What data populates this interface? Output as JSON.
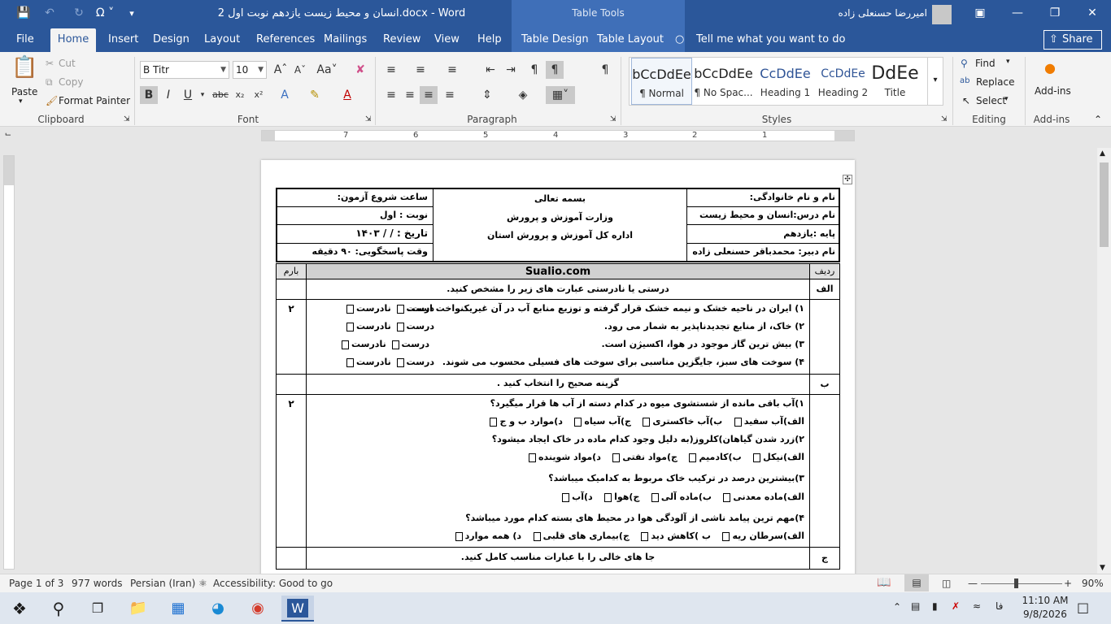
{
  "window": {
    "title": "انسان و محیط زیست یازدهم نوبت اول 2.docx - Word",
    "table_tools": "Table Tools",
    "user": "امیررضا حسنعلی زاده"
  },
  "tabs": [
    "File",
    "Home",
    "Insert",
    "Design",
    "Layout",
    "References",
    "Mailings",
    "Review",
    "View",
    "Help",
    "Table Design",
    "Table Layout"
  ],
  "tell_me": "Tell me what you want to do",
  "share": "Share",
  "clipboard": {
    "paste": "Paste",
    "cut": "Cut",
    "copy": "Copy",
    "format_painter": "Format Painter",
    "label": "Clipboard"
  },
  "font": {
    "name": "B Titr",
    "size": "10",
    "label": "Font"
  },
  "paragraph": {
    "label": "Paragraph"
  },
  "styles": {
    "label": "Styles",
    "items": [
      {
        "preview": "bCcDdEe",
        "name": "¶ Normal"
      },
      {
        "preview": "bCcDdEe",
        "name": "¶ No Spac..."
      },
      {
        "preview": "CcDdEe",
        "name": "Heading 1"
      },
      {
        "preview": "CcDdEe",
        "name": "Heading 2"
      },
      {
        "preview": "DdEe",
        "name": "Title"
      }
    ]
  },
  "editing": {
    "find": "Find",
    "replace": "Replace",
    "select": "Select",
    "label": "Editing"
  },
  "addins": {
    "button": "Add-ins",
    "label": "Add-ins"
  },
  "ruler": {
    "numbers": [
      "7",
      "6",
      "5",
      "4",
      "3",
      "2",
      "1"
    ]
  },
  "doc": {
    "header": {
      "name": "نام و نام خانوادگی:",
      "course": "نام درس:انسان و محیط زیست",
      "grade": "پایه :یازدهم",
      "teacher": "نام دبیر: محمدباقر حسنعلی زاده",
      "center1": "بسمه تعالی",
      "center2": "وزارت آموزش و پرورش",
      "center3": "اداره کل آموزش و پرورش استان",
      "start": "ساعت شروع آزمون:",
      "term": "نوبت   : اول",
      "date": "تاریخ   :     /    /  ۱۴۰۳",
      "duration": "وقت پاسخگویی: ۹۰ دقیقه"
    },
    "col_row": "ردیف",
    "col_site": "Sualio.com",
    "col_score": "بارم",
    "sec_a": {
      "letter": "الف",
      "title": "درستی یا نادرستی عبارت های زیر را مشخص کنید.",
      "score": "۲",
      "items": [
        "۱) ایران در ناحیه خشک و نیمه خشک قرار گرفته و توزیع منابع آب در آن غیریکنواخت است.",
        "۲) خاک، از منابع تجدیدناپذیر به شمار می رود.",
        "۳) بیش ترین گاز موجود در هوا، اکسیژن است.",
        "۴) سوخت های سبز، جایگزین مناسبی برای سوخت های فسیلی محسوب می شوند."
      ],
      "true": "درست",
      "false": "نادرست"
    },
    "sec_b": {
      "letter": "ب",
      "title": "گزینه صحیح را انتخاب کنید .",
      "score": "۲",
      "q1": "۱)آب باقی مانده از شستشوی میوه در کدام دسته از آب ها قرار میگیرد؟",
      "q1o": [
        "الف)آب سفید",
        "ب)آب خاکستری",
        "ج)آب سیاه",
        "د)موارد ب و ج"
      ],
      "q2": "۲)زرد شدن گیاهان)کلروز(به دلیل وجود کدام ماده در خاک ایجاد میشود؟",
      "q2o": [
        "الف)نیکل",
        "ب)کادمیم",
        "ج)مواد نفتی",
        "د)مواد شوینده"
      ],
      "q3": "۳)بیشترین درصد در ترکیب خاک مربوط به کدامیک میباشد؟",
      "q3o": [
        "الف)ماده معدنی",
        "ب)ماده آلی",
        "ج)هوا",
        "د)آب"
      ],
      "q4": "۴)مهم ترین پیامد ناشی از آلودگی هوا در محیط های بسته کدام مورد میباشد؟",
      "q4o": [
        "الف)سرطان ریه",
        "ب )کاهش دید",
        "ج)بیماری های قلبی",
        "د) همه موارد"
      ]
    },
    "sec_c": {
      "letter": "ج",
      "title": "جا های خالی را با عبارات مناسب کامل کنید."
    }
  },
  "status": {
    "page": "Page 1 of 3",
    "words": "977 words",
    "language": "Persian (Iran)",
    "accessibility": "Accessibility: Good to go",
    "zoom": "90%"
  },
  "taskbar": {
    "time": "11:10 AM",
    "date": "9/8/2026",
    "lang": "فا"
  }
}
